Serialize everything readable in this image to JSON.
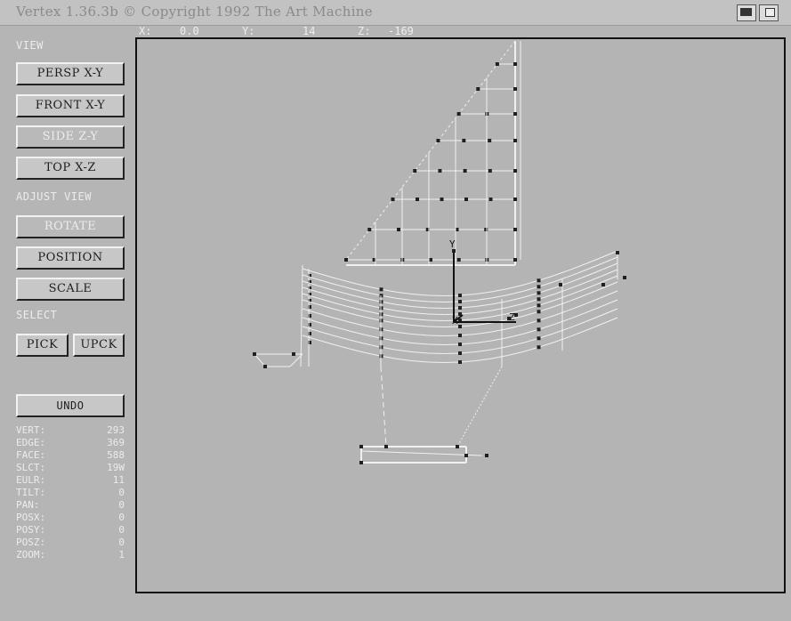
{
  "title_bar": {
    "title": "Vertex 1.36.3b  © Copyright 1992 The Art Machine"
  },
  "coords": {
    "x_label": "X:",
    "x_value": "0.0",
    "y_label": "Y:",
    "y_value": "14",
    "z_label": "Z:",
    "z_value": "-169"
  },
  "sidebar": {
    "view_label": "VIEW",
    "persp_button": "PERSP X-Y",
    "front_button": "FRONT X-Y",
    "side_button": "SIDE Z-Y",
    "top_button": "TOP X-Z",
    "adjust_label": "ADJUST VIEW",
    "rotate_button": "ROTATE",
    "position_button": "POSITION",
    "scale_button": "SCALE",
    "select_label": "SELECT",
    "pick_button": "PICK",
    "upck_button": "UPCK",
    "undo_button": "UNDO"
  },
  "stats": [
    {
      "label": "VERT:",
      "value": "293"
    },
    {
      "label": "EDGE:",
      "value": "369"
    },
    {
      "label": "FACE:",
      "value": "588"
    },
    {
      "label": "SLCT:",
      "value": "19W"
    },
    {
      "label": "EULR:",
      "value": "11"
    },
    {
      "label": "TILT:",
      "value": "0"
    },
    {
      "label": "PAN:",
      "value": "0"
    },
    {
      "label": "POSX:",
      "value": "0"
    },
    {
      "label": "POSY:",
      "value": "0"
    },
    {
      "label": "POSZ:",
      "value": "0"
    },
    {
      "label": "ZOOM:",
      "value": "1"
    }
  ],
  "viewport": {
    "axis_y_label": "Y",
    "axis_x_label": "X",
    "axis_z_label": "Z"
  },
  "colors": {
    "background": "#b5b5b5",
    "wireframe": "#f0f0f0",
    "vertex": "#202020",
    "axis": "#111111"
  }
}
